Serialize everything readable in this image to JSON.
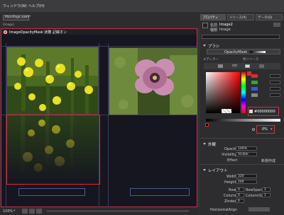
{
  "menu": {
    "window": "ウィンドウ(W)",
    "help": "ヘルプ(H)"
  },
  "doc": {
    "tab": "MainPage.xaml*",
    "close": "×",
    "breadcrumb": "[Image]"
  },
  "canvas": {
    "status_text": "ImageOpacityMask 状態 記録オン",
    "zoom": "100%"
  },
  "panel": {
    "tabs": [
      "プロパティ",
      "リソース(R)",
      "データ(D)"
    ],
    "name_label": "名前",
    "name_value": "Image2",
    "type_label": "種類",
    "type_value": "Image",
    "brush_section": "ブラシ",
    "brush_property": "OpacityMask",
    "editor_label": "エディター",
    "color_resource": "色リソース",
    "hex_value": "#00000000",
    "alpha_value": "0%",
    "appearance_section": "外観",
    "opacity_label": "Opacity",
    "opacity_value": "100%",
    "visibility_label": "Visibility",
    "visibility_value": "Visible",
    "effect_label": "Effect",
    "effect_value": "新規作成",
    "layout_section": "レイアウト",
    "width_label": "Width",
    "width_value": "320",
    "height_label": "Height",
    "height_value": "240",
    "row_label": "Row",
    "row_value": "0",
    "rowspan_label": "RowSpan",
    "rowspan_value": "1",
    "column_label": "Column",
    "column_value": "0",
    "colspan_label": "ColumnSpan",
    "colspan_value": "1",
    "zindex_label": "ZIndex",
    "zindex_value": "0",
    "halign_label": "HorizontalAlign"
  },
  "colors": {
    "accent_red": "#e02b2b",
    "selection": "#c0304a"
  }
}
